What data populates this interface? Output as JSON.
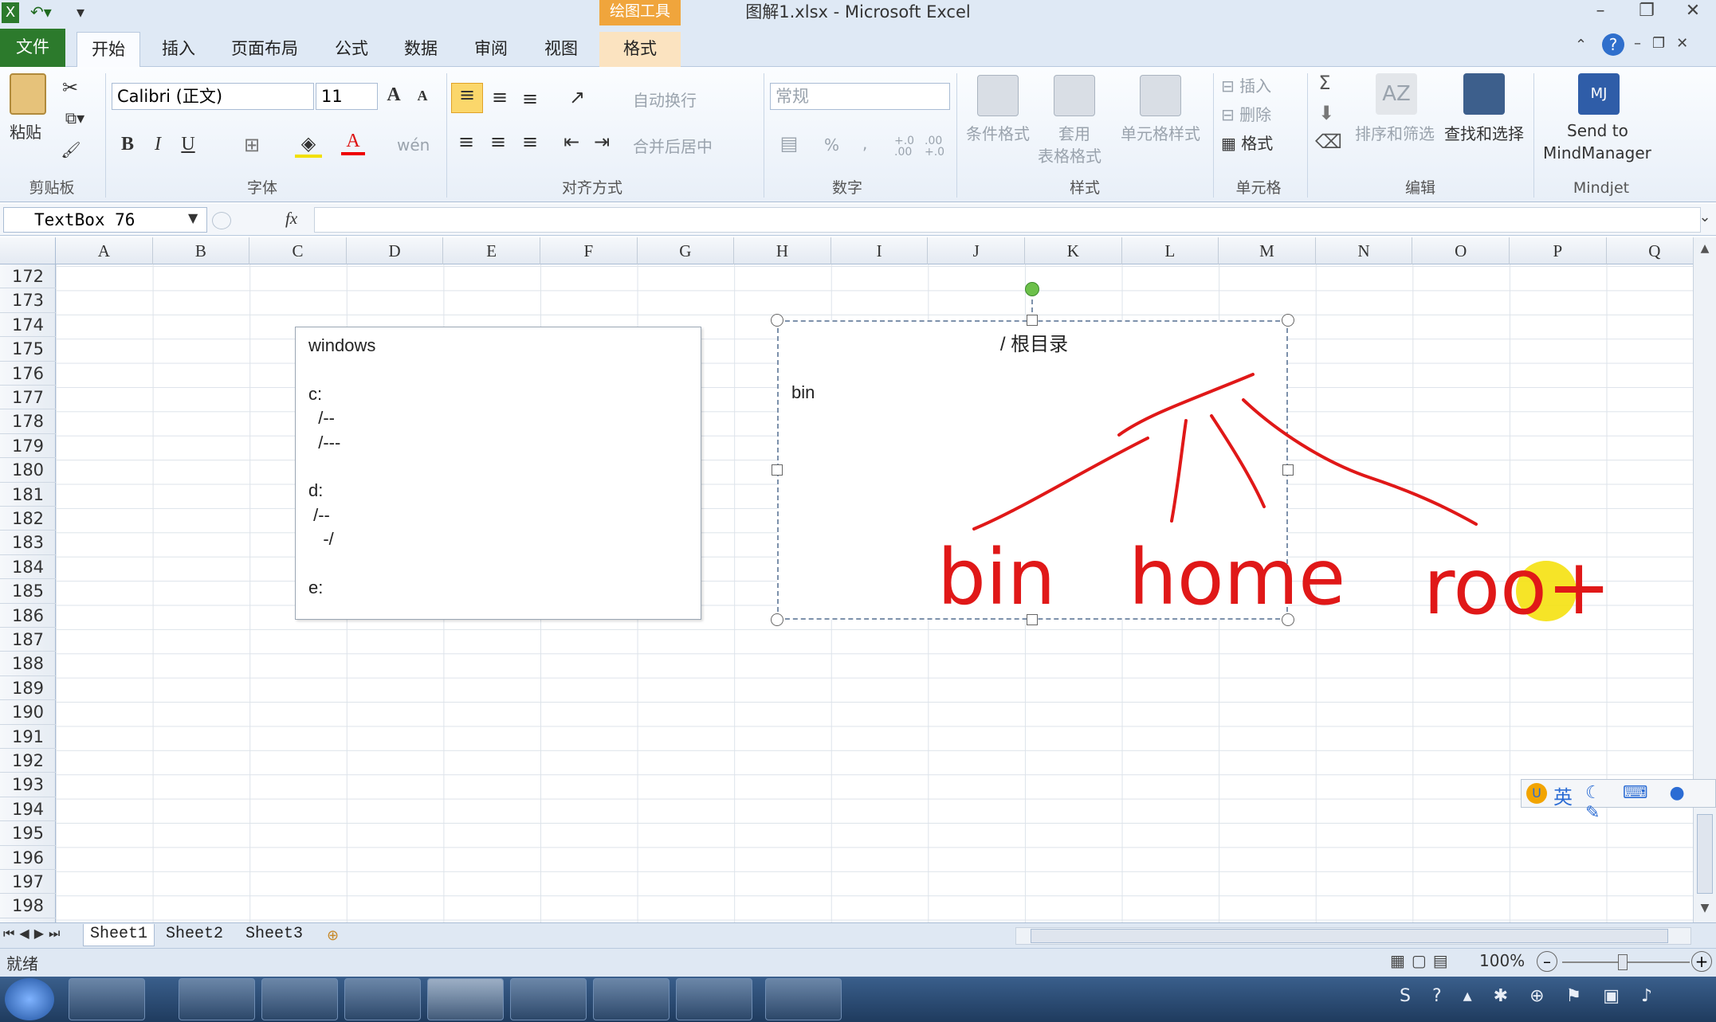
{
  "window": {
    "title": "图解1.xlsx - Microsoft Excel",
    "contextual_tools": "绘图工具"
  },
  "tabs": {
    "file": "文件",
    "home": "开始",
    "insert": "插入",
    "page_layout": "页面布局",
    "formulas": "公式",
    "data": "数据",
    "review": "审阅",
    "view": "视图",
    "format": "格式"
  },
  "ribbon": {
    "clipboard": {
      "paste": "粘贴",
      "label": "剪贴板"
    },
    "font": {
      "name": "Calibri (正文)",
      "size": "11",
      "bold": "B",
      "italic": "I",
      "underline": "U",
      "grow": "A",
      "shrink": "A",
      "label": "字体",
      "phonetic": "wén"
    },
    "alignment": {
      "wrap": "自动换行",
      "merge": "合并后居中",
      "label": "对齐方式"
    },
    "number": {
      "format": "常规",
      "percent": "%",
      "comma": ",",
      "inc": "+.0 .00",
      "dec": ".00 +.0",
      "label": "数字"
    },
    "styles": {
      "conditional": "条件格式",
      "table_1": "套用",
      "table_2": "表格格式",
      "cell_styles": "单元格样式",
      "label": "样式"
    },
    "cells": {
      "insert": "插入",
      "delete": "删除",
      "format": "格式",
      "label": "单元格"
    },
    "editing": {
      "sigma": "Σ",
      "sort_filter": "排序和筛选",
      "find_select": "查找和选择",
      "label": "编辑"
    },
    "mindjet": {
      "send_1": "Send to",
      "send_2": "MindManager",
      "label": "Mindjet"
    }
  },
  "formula_bar": {
    "name_box": "TextBox 76",
    "fx": "fx",
    "value": ""
  },
  "columns": [
    "A",
    "B",
    "C",
    "D",
    "E",
    "F",
    "G",
    "H",
    "I",
    "J",
    "K",
    "L",
    "M",
    "N",
    "O",
    "P",
    "Q"
  ],
  "rows": [
    "172",
    "173",
    "174",
    "175",
    "176",
    "177",
    "178",
    "179",
    "180",
    "181",
    "182",
    "183",
    "184",
    "185",
    "186",
    "187",
    "188",
    "189",
    "190",
    "191",
    "192",
    "193",
    "194",
    "195",
    "196",
    "197",
    "198"
  ],
  "textbox_left": {
    "lines": [
      "windows",
      "",
      "c:",
      "  /--",
      "  /---",
      "",
      "d:",
      " /--",
      "   -/",
      "",
      "e:"
    ]
  },
  "textbox_right": {
    "title": "/ 根目录",
    "text": "bin",
    "handwriting": [
      "bin",
      "home",
      "roo+"
    ]
  },
  "sheets": [
    "Sheet1",
    "Sheet2",
    "Sheet3"
  ],
  "status": {
    "ready": "就绪",
    "zoom": "100%"
  },
  "ime": {
    "lang": "英"
  },
  "colors": {
    "office_green": "#2c7a2c",
    "tools_orange": "#f0a53c",
    "annotation_red": "#e01818",
    "highlight_yellow": "#f5e10f"
  }
}
